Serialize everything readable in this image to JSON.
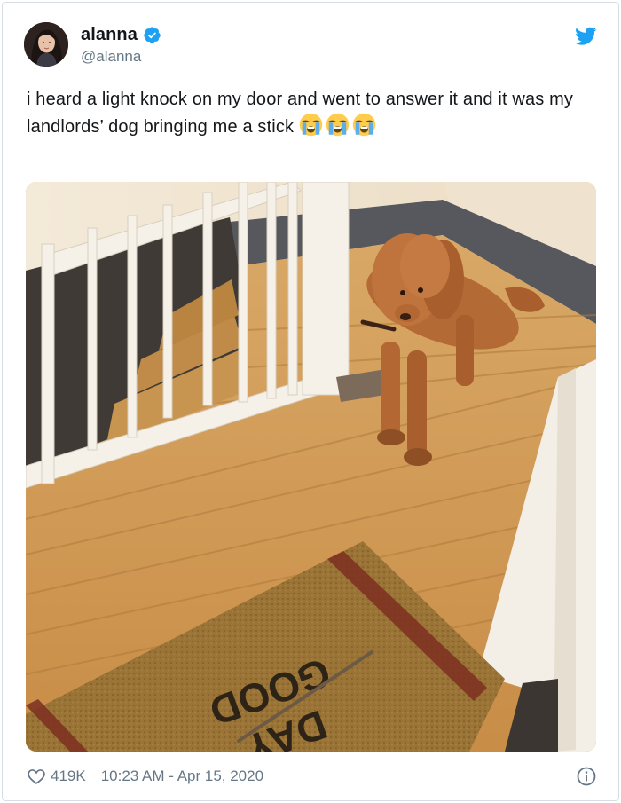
{
  "tweet": {
    "author": {
      "display_name": "alanna",
      "handle": "@alanna",
      "verified": true
    },
    "text": "i heard a light knock on my door and went to answer it and it was my landlords’ dog bringing me a stick",
    "emojis": [
      "loudly-crying-face",
      "loudly-crying-face",
      "loudly-crying-face"
    ],
    "media": {
      "doormat_text": [
        "GOOD",
        "DAY"
      ]
    },
    "footer": {
      "like_count": "419K",
      "timestamp": "10:23 AM - Apr 15, 2020"
    }
  },
  "icons": {
    "verified": "verified-badge-icon",
    "brand": "twitter-bird-icon",
    "like": "heart-outline-icon",
    "info": "info-circle-icon"
  },
  "colors": {
    "brand_blue": "#1da1f2",
    "secondary_text": "#657786",
    "primary_text": "#14171a",
    "border": "#d7dde2"
  }
}
